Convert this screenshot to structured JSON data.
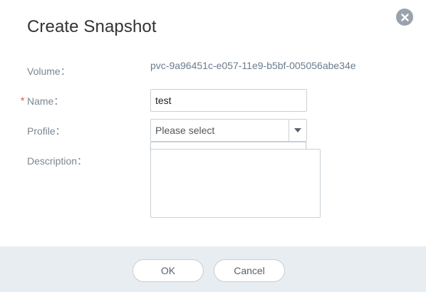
{
  "dialog": {
    "title": "Create Snapshot",
    "close_icon": "close-icon"
  },
  "form": {
    "volume": {
      "label": "Volume：",
      "value": "pvc-9a96451c-e057-11e9-b5bf-005056abe34e"
    },
    "name": {
      "required_mark": "*",
      "label": "Name：",
      "value": "test"
    },
    "profile": {
      "label": "Profile：",
      "placeholder": "Please select",
      "arrow_icon": "caret-down-icon"
    },
    "description": {
      "label": "Description：",
      "value": ""
    }
  },
  "footer": {
    "ok_label": "OK",
    "cancel_label": "Cancel"
  },
  "colors": {
    "label": "#7b8692",
    "required": "#e64b3c",
    "footer_bg": "#e8edf1",
    "close_bg": "#9aa3ad"
  }
}
